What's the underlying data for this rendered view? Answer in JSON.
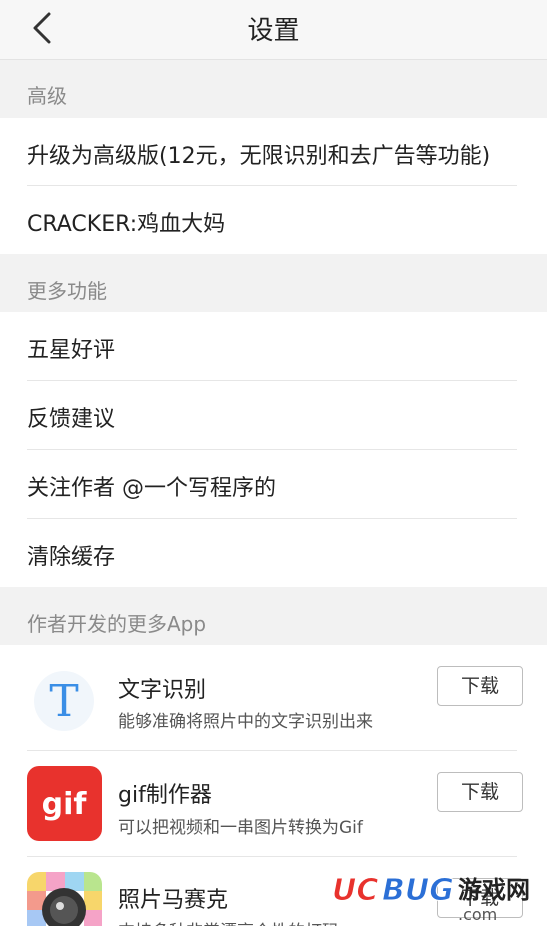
{
  "header": {
    "title": "设置"
  },
  "sections": {
    "advanced": {
      "title": "高级",
      "items": [
        {
          "label": "升级为高级版(12元，无限识别和去广告等功能)"
        },
        {
          "label": "CRACKER:鸡血大妈"
        }
      ]
    },
    "more": {
      "title": "更多功能",
      "items": [
        {
          "label": "五星好评"
        },
        {
          "label": "反馈建议"
        },
        {
          "label": "关注作者 @一个写程序的"
        },
        {
          "label": "清除缓存"
        }
      ]
    },
    "apps": {
      "title": "作者开发的更多App",
      "items": [
        {
          "name": "文字识别",
          "desc": "能够准确将照片中的文字识别出来",
          "button": "下载",
          "icon": "text-recognition-app-icon",
          "icon_letter": "T"
        },
        {
          "name": "gif制作器",
          "desc": "可以把视频和一串图片转换为Gif",
          "button": "下载",
          "icon": "gif-maker-app-icon",
          "icon_text": "gif"
        },
        {
          "name": "照片马赛克",
          "desc": "支持多种非常漂亮个性的打码",
          "button": "下载",
          "icon": "photo-mosaic-app-icon"
        }
      ]
    }
  },
  "watermark": {
    "brand": "UCBUG",
    "text": "游戏网",
    "url": ".com"
  },
  "colors": {
    "section_bg": "#f2f2f2",
    "section_text": "#8a8a8a",
    "gif_red": "#e8322d",
    "text_icon_blue": "#3a8ee6"
  }
}
